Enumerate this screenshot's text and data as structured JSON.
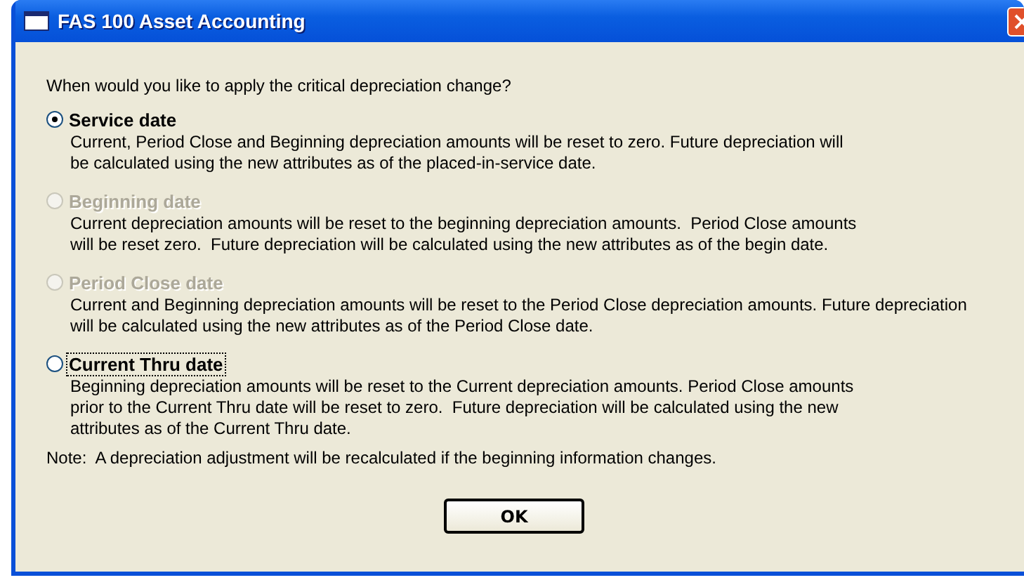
{
  "window": {
    "title": "FAS 100 Asset Accounting"
  },
  "question": "When would you like to apply the critical depreciation change?",
  "options": [
    {
      "label": "Service date",
      "selected": true,
      "disabled": false,
      "focused": false,
      "lines": [
        "Current, Period Close and Beginning depreciation amounts will be reset to zero. Future depreciation will",
        "be calculated using the new attributes as of the placed-in-service date."
      ]
    },
    {
      "label": "Beginning date",
      "selected": false,
      "disabled": true,
      "focused": false,
      "lines": [
        "Current depreciation amounts will be reset to the beginning depreciation amounts.  Period Close amounts",
        "will be reset zero.  Future depreciation will be calculated using the new attributes as of the begin date."
      ]
    },
    {
      "label": "Period Close date",
      "selected": false,
      "disabled": true,
      "focused": false,
      "lines": [
        "Current and Beginning depreciation amounts will be reset to the Period Close depreciation amounts. Future depreciation",
        "will be calculated using the new attributes as of the Period Close date."
      ]
    },
    {
      "label": "Current Thru date",
      "selected": false,
      "disabled": false,
      "focused": true,
      "lines": [
        "Beginning depreciation amounts will be reset to the Current depreciation amounts. Period Close amounts",
        "prior to the Current Thru date will be reset to zero.  Future depreciation will be calculated using the new",
        "attributes as of the Current Thru date."
      ]
    }
  ],
  "note": "Note:  A depreciation adjustment will be recalculated if the beginning information changes.",
  "buttons": [
    "OK"
  ]
}
